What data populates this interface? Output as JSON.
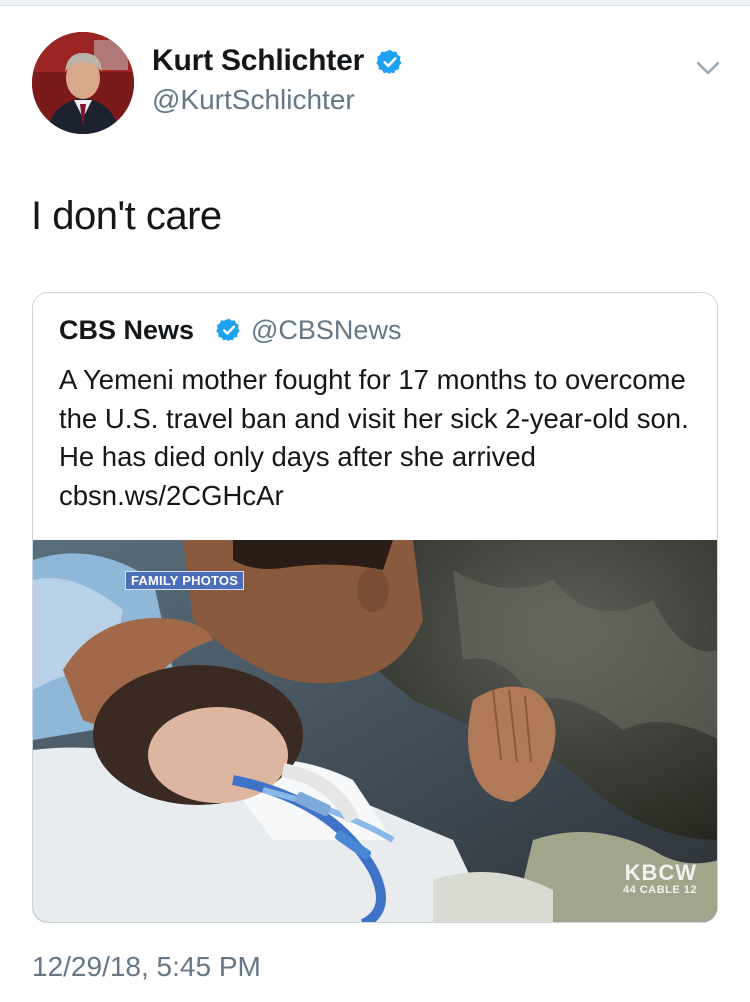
{
  "author": {
    "display_name": "Kurt Schlichter",
    "handle": "@KurtSchlichter",
    "verified": true,
    "avatar_icon": "profile-photo"
  },
  "tweet": {
    "text": "I don't care",
    "timestamp": "12/29/18, 5:45 PM",
    "menu_icon": "chevron-down-icon"
  },
  "quoted_tweet": {
    "display_name": "CBS News",
    "handle": "@CBSNews",
    "verified": true,
    "text": "A Yemeni mother fought for 17 months to overcome the U.S. travel ban and visit her sick 2-year-old son. He has died only days after she arrived cbsn.ws/2CGHcAr",
    "media": {
      "caption_tag": "FAMILY PHOTOS",
      "watermark": "KBCW",
      "watermark_sub": "44 CABLE 12"
    }
  },
  "colors": {
    "text_primary": "#14171a",
    "text_secondary": "#657786",
    "verified_blue": "#1da1f2",
    "card_border": "#ccd6dd",
    "tag_blue": "#4a6fb8"
  }
}
